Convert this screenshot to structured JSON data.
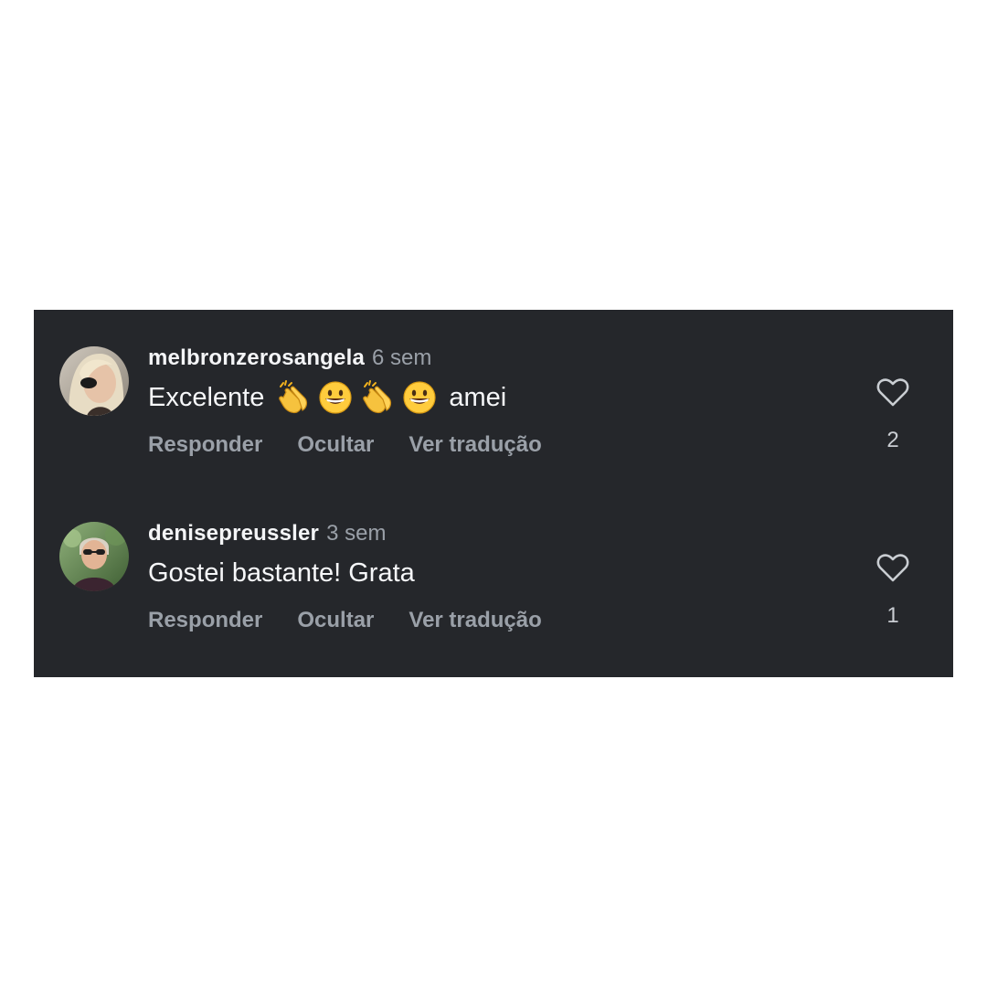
{
  "comments": [
    {
      "username": "melbronzerosangela",
      "time": "6 sem",
      "text_before": "Excelente",
      "emojis": [
        "clapping-hands-emoji",
        "grinning-face-emoji",
        "clapping-hands-emoji",
        "grinning-face-emoji"
      ],
      "text_after": "amei",
      "likes": "2",
      "actions": {
        "reply": "Responder",
        "hide": "Ocultar",
        "translate": "Ver tradução"
      }
    },
    {
      "username": "denisepreussler",
      "time": "3 sem",
      "text": "Gostei bastante! Grata",
      "likes": "1",
      "actions": {
        "reply": "Responder",
        "hide": "Ocultar",
        "translate": "Ver tradução"
      }
    }
  ],
  "colors": {
    "panel_bg": "#25272b",
    "primary_text": "#f4f5f7",
    "secondary_text": "#9aa0a8"
  }
}
